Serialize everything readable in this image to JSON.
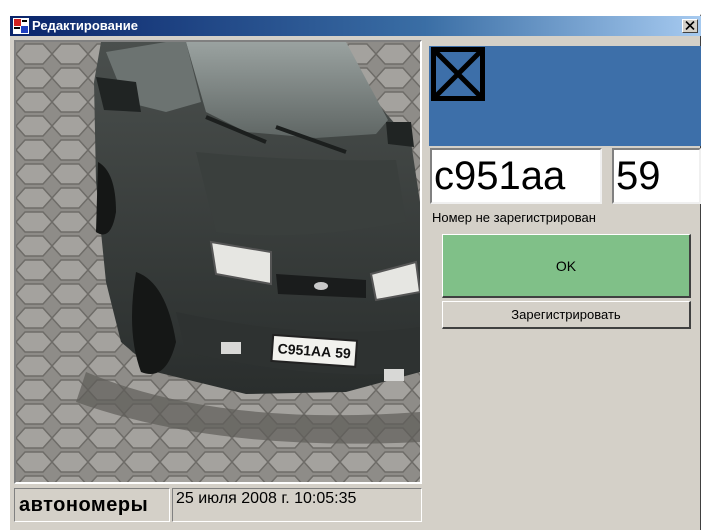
{
  "window": {
    "title": "Редактирование",
    "icons": {
      "app": "app-logo-icon",
      "close": "close-icon"
    }
  },
  "photo": {
    "plate_text": "С951АА 59",
    "brand": "автономеры",
    "timestamp": "25 июля 2008 г. 10:05:35"
  },
  "plate": {
    "thumbnail_icon": "no-image-icon",
    "number": "с951аа",
    "region": "59",
    "status": "Номер не зарегистрирован"
  },
  "actions": {
    "ok_label": "OK",
    "register_label": "Зарегистрировать"
  },
  "colors": {
    "banner": "#3d6fa9",
    "ok_button": "#80c088",
    "window_bg": "#d4d0c8"
  }
}
